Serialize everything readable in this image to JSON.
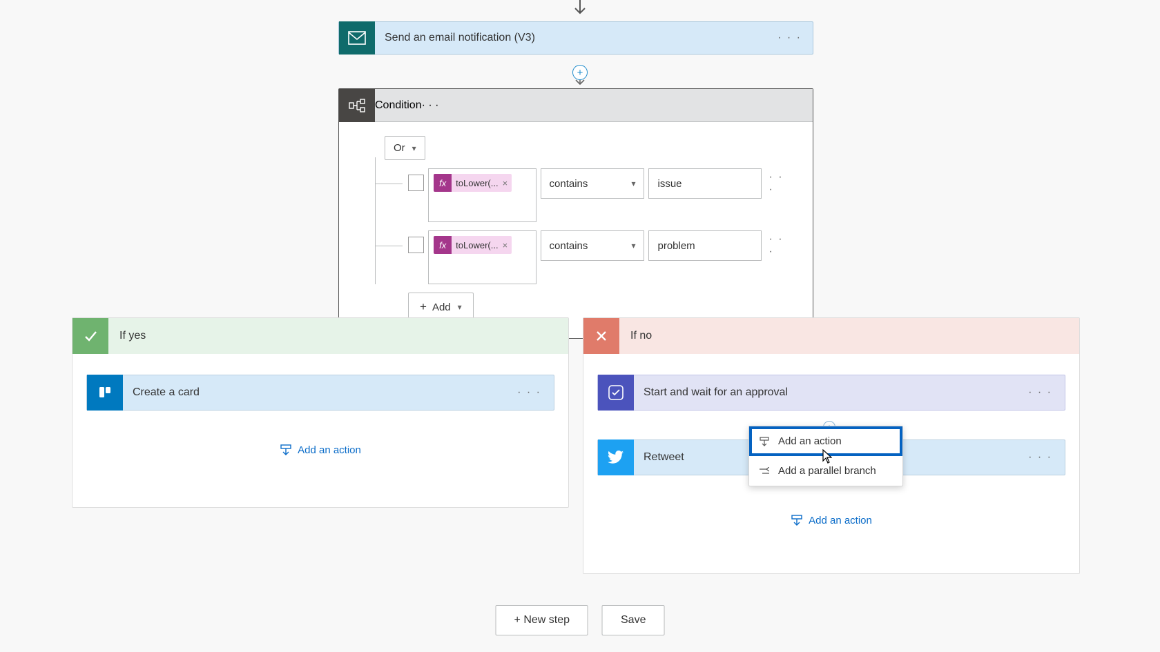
{
  "email_card": {
    "title": "Send an email notification (V3)"
  },
  "condition": {
    "title": "Condition",
    "group_op": "Or",
    "rows": [
      {
        "token": "toLower(...",
        "operator": "contains",
        "value": "issue"
      },
      {
        "token": "toLower(...",
        "operator": "contains",
        "value": "problem"
      }
    ],
    "add_label": "Add"
  },
  "branches": {
    "yes": {
      "title": "If yes",
      "cards": [
        {
          "title": "Create a card"
        }
      ],
      "add_action": "Add an action"
    },
    "no": {
      "title": "If no",
      "cards": [
        {
          "title": "Start and wait for an approval"
        },
        {
          "title": "Retweet"
        }
      ],
      "add_action": "Add an action"
    }
  },
  "popover": {
    "add_action": "Add an action",
    "add_parallel": "Add a parallel branch"
  },
  "footer": {
    "new_step": "+ New step",
    "save": "Save"
  }
}
